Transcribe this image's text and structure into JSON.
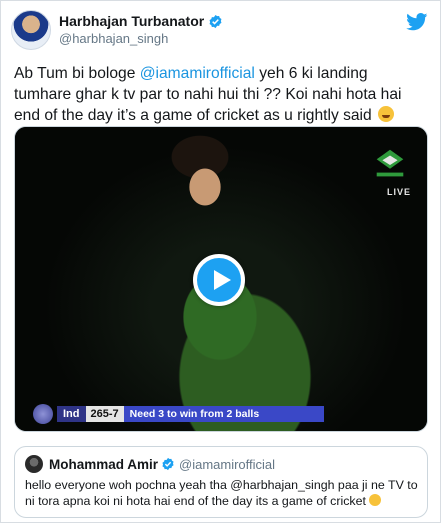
{
  "author": {
    "display_name": "Harbhajan Turbanator",
    "handle": "@harbhajan_singh",
    "verified_icon": "verified-badge-icon",
    "avatar_icon": "avatar"
  },
  "platform_icon": "twitter-bird-icon",
  "tweet": {
    "line1_prefix": "Ab Tum bi bologe ",
    "line1_mention": "@iamamirofficial",
    "line1_suffix": " yeh 6 ki landing",
    "line2": "tumhare ghar k tv par to nahi hui thi ??  Koi nahi hota hai",
    "line3": "end of the day it’s a game of cricket as u rightly said",
    "emoji_icon": "rolling-on-floor-laughing-emoji-icon"
  },
  "media": {
    "broadcast_badge": "LIVE",
    "play_icon": "play-icon",
    "scoreboard": {
      "team": "Ind",
      "score": "265-7",
      "message": "Need 3 to win from 2 balls"
    }
  },
  "quoted_tweet": {
    "display_name": "Mohammad Amir",
    "handle": "@iamamirofficial",
    "line1": "hello everyone  woh pochna yeah tha @harbhajan_singh paa ji ne TV to",
    "line2": "ni tora apna koi ni hota  hai end of the day its a game of cricket",
    "emoji_icon": "smiling-face-emoji-icon"
  },
  "colors": {
    "accent": "#1da1f2",
    "mention": "#1b95e0",
    "secondary_text": "#657786"
  }
}
